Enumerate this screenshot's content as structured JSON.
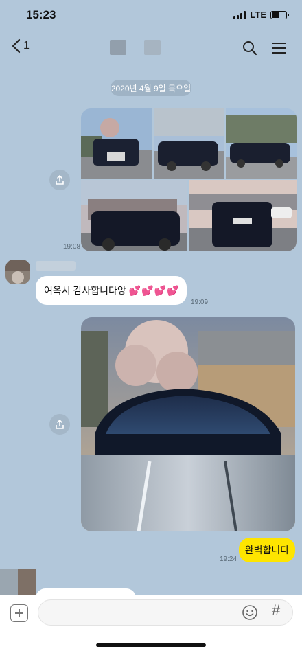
{
  "status_bar": {
    "time": "15:23",
    "network": "LTE",
    "battery_level": 0.6
  },
  "header": {
    "back_count": "1",
    "icons": [
      "back-chevron-icon",
      "search-icon",
      "menu-icon"
    ]
  },
  "chat": {
    "date_divider": "2020년 4월 9일 목요일",
    "messages": [
      {
        "sender": "me",
        "type": "photo-grid",
        "photo_count": 5,
        "time": "19:08"
      },
      {
        "sender": "other",
        "type": "text",
        "text": "여옥시 감사합니다앙",
        "hearts": "💕💕💕💕",
        "time": "19:09"
      },
      {
        "sender": "me",
        "type": "photo",
        "photo_count": 1
      },
      {
        "sender": "me",
        "type": "text",
        "text": "완벽합니다",
        "time": "19:24"
      }
    ]
  },
  "input_bar": {
    "placeholder": "",
    "hash_label": "#"
  },
  "colors": {
    "chat_background": "#b2c7da",
    "my_bubble": "#fee500",
    "other_bubble": "#ffffff"
  }
}
